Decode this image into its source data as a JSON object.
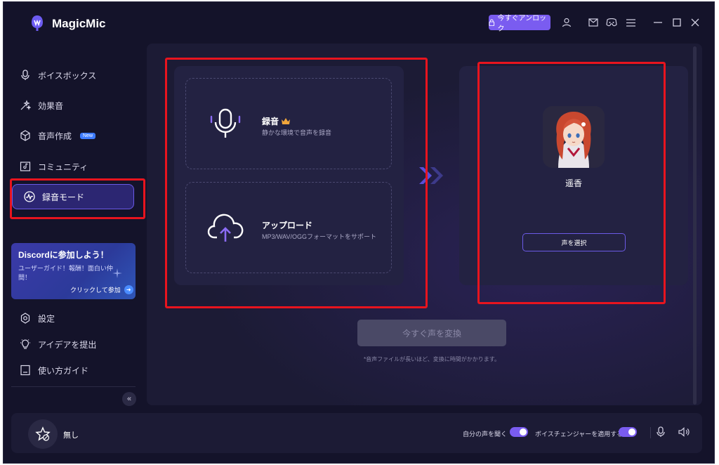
{
  "app": {
    "name": "MagicMic",
    "unlock_label": "今すぐアンロック"
  },
  "titlebar_icons": [
    "user-icon",
    "mail-icon",
    "discord-icon",
    "menu-icon",
    "minimize-icon",
    "maximize-icon",
    "close-icon"
  ],
  "sidebar": {
    "items": [
      {
        "label": "ボイスボックス",
        "icon": "microphone-icon"
      },
      {
        "label": "効果音",
        "icon": "sparkle-icon"
      },
      {
        "label": "音声作成",
        "icon": "cube-icon",
        "badge": "New"
      },
      {
        "label": "コミュニティ",
        "icon": "community-icon"
      },
      {
        "label": "録音モード",
        "icon": "waveform-icon",
        "active": true
      }
    ],
    "discord": {
      "title": "Discordに参加しよう！",
      "text": "ユーザーガイド！報酬！面白い仲間！",
      "link": "クリックして参加"
    },
    "bottom_items": [
      {
        "label": "設定",
        "icon": "gear-icon"
      },
      {
        "label": "アイデアを提出",
        "icon": "lightbulb-icon"
      },
      {
        "label": "使い方ガイド",
        "icon": "guide-icon"
      }
    ]
  },
  "main": {
    "record": {
      "title": "録音",
      "desc": "静かな環境で音声を録音"
    },
    "upload": {
      "title": "アップロード",
      "desc": "MP3/WAV/OGGフォーマットをサポート"
    },
    "voice": {
      "name": "遥香",
      "select_label": "声を選択"
    },
    "convert_label": "今すぐ声を変換",
    "convert_note": "*音声ファイルが長いほど、変換に時間がかかります。"
  },
  "bottombar": {
    "effect_name": "無し",
    "hear_self_label": "自分の声を聞く",
    "apply_changer_label": "ボイスチェンジャーを適用する",
    "hear_self_on": true,
    "apply_changer_on": true
  },
  "colors": {
    "accent": "#7a5cf0",
    "highlight": "#e8141e",
    "background": "#14132a"
  }
}
